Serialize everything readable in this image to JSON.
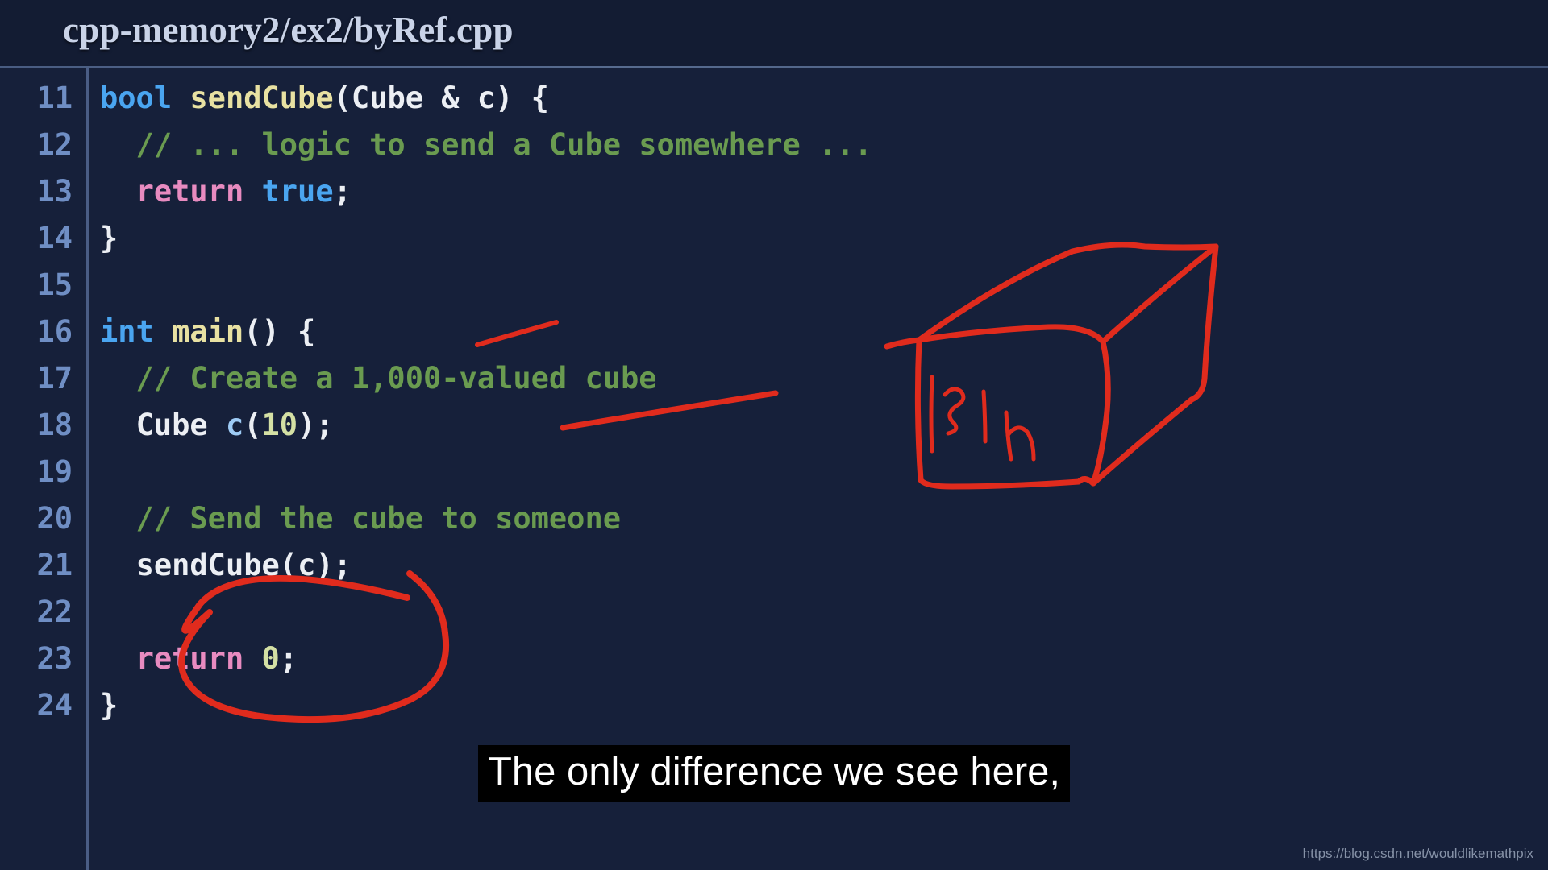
{
  "window": {
    "title": "cpp-memory2/ex2/byRef.cpp"
  },
  "editor": {
    "language": "cpp",
    "first_line_number": 11,
    "colors": {
      "background": "#16203a",
      "gutter_text": "#6f8ec4",
      "keyword": "#4aa5f0",
      "function": "#e8e1a2",
      "comment": "#6a9b50",
      "type": "#eceff4",
      "return_keyword": "#e88bc0",
      "number": "#d4e0a4",
      "variable": "#9ecbf5",
      "annotation_red": "#e02b1d"
    },
    "lines": [
      {
        "n": "11",
        "tokens": [
          {
            "t": "bool",
            "c": "t-kw"
          },
          {
            "t": " ",
            "c": "t-pun"
          },
          {
            "t": "sendCube",
            "c": "t-fn"
          },
          {
            "t": "(",
            "c": "t-pun"
          },
          {
            "t": "Cube",
            "c": "t-type"
          },
          {
            "t": " & ",
            "c": "t-pun"
          },
          {
            "t": "c",
            "c": "t-type"
          },
          {
            "t": ") {",
            "c": "t-pun"
          }
        ]
      },
      {
        "n": "12",
        "tokens": [
          {
            "t": "  // ... logic to send a Cube somewhere ...",
            "c": "t-cmt"
          }
        ]
      },
      {
        "n": "13",
        "tokens": [
          {
            "t": "  ",
            "c": "t-pun"
          },
          {
            "t": "return",
            "c": "t-ret"
          },
          {
            "t": " ",
            "c": "t-pun"
          },
          {
            "t": "true",
            "c": "t-bool"
          },
          {
            "t": ";",
            "c": "t-pun"
          }
        ]
      },
      {
        "n": "14",
        "tokens": [
          {
            "t": "}",
            "c": "t-pun"
          }
        ]
      },
      {
        "n": "15",
        "tokens": [
          {
            "t": "",
            "c": "t-pun"
          }
        ]
      },
      {
        "n": "16",
        "tokens": [
          {
            "t": "int",
            "c": "t-kw"
          },
          {
            "t": " ",
            "c": "t-pun"
          },
          {
            "t": "main",
            "c": "t-fn"
          },
          {
            "t": "() {",
            "c": "t-pun"
          }
        ]
      },
      {
        "n": "17",
        "tokens": [
          {
            "t": "  // Create a 1,000-valued cube",
            "c": "t-cmt"
          }
        ]
      },
      {
        "n": "18",
        "tokens": [
          {
            "t": "  ",
            "c": "t-pun"
          },
          {
            "t": "Cube",
            "c": "t-type"
          },
          {
            "t": " ",
            "c": "t-pun"
          },
          {
            "t": "c",
            "c": "t-var"
          },
          {
            "t": "(",
            "c": "t-pun"
          },
          {
            "t": "10",
            "c": "t-num"
          },
          {
            "t": ");",
            "c": "t-pun"
          }
        ]
      },
      {
        "n": "19",
        "tokens": [
          {
            "t": "",
            "c": "t-pun"
          }
        ]
      },
      {
        "n": "20",
        "tokens": [
          {
            "t": "  // Send the cube to someone",
            "c": "t-cmt"
          }
        ]
      },
      {
        "n": "21",
        "tokens": [
          {
            "t": "  ",
            "c": "t-pun"
          },
          {
            "t": "sendCube",
            "c": "t-type"
          },
          {
            "t": "(",
            "c": "t-pun"
          },
          {
            "t": "c",
            "c": "t-type"
          },
          {
            "t": ");",
            "c": "t-pun"
          }
        ]
      },
      {
        "n": "22",
        "tokens": [
          {
            "t": "",
            "c": "t-pun"
          }
        ]
      },
      {
        "n": "23",
        "tokens": [
          {
            "t": "  ",
            "c": "t-pun"
          },
          {
            "t": "return",
            "c": "t-ret"
          },
          {
            "t": " ",
            "c": "t-pun"
          },
          {
            "t": "0",
            "c": "t-num"
          },
          {
            "t": ";",
            "c": "t-pun"
          }
        ]
      },
      {
        "n": "24",
        "tokens": [
          {
            "t": "}",
            "c": "t-pun"
          }
        ]
      }
    ]
  },
  "annotations": {
    "ink_color": "#e02b1d",
    "items": [
      {
        "name": "underline-stroke-near-main",
        "kind": "stroke"
      },
      {
        "name": "underline-stroke-under-comment",
        "kind": "stroke"
      },
      {
        "name": "hand-drawn-cube",
        "kind": "shape"
      },
      {
        "name": "cube-inner-scribble",
        "kind": "handwriting",
        "text": "1s | h"
      },
      {
        "name": "circle-around-sendcube-call",
        "kind": "ellipse"
      }
    ]
  },
  "subtitle": {
    "text": "The only difference we see here,"
  },
  "watermark": {
    "text": "https://blog.csdn.net/wouldlikemathpix"
  }
}
